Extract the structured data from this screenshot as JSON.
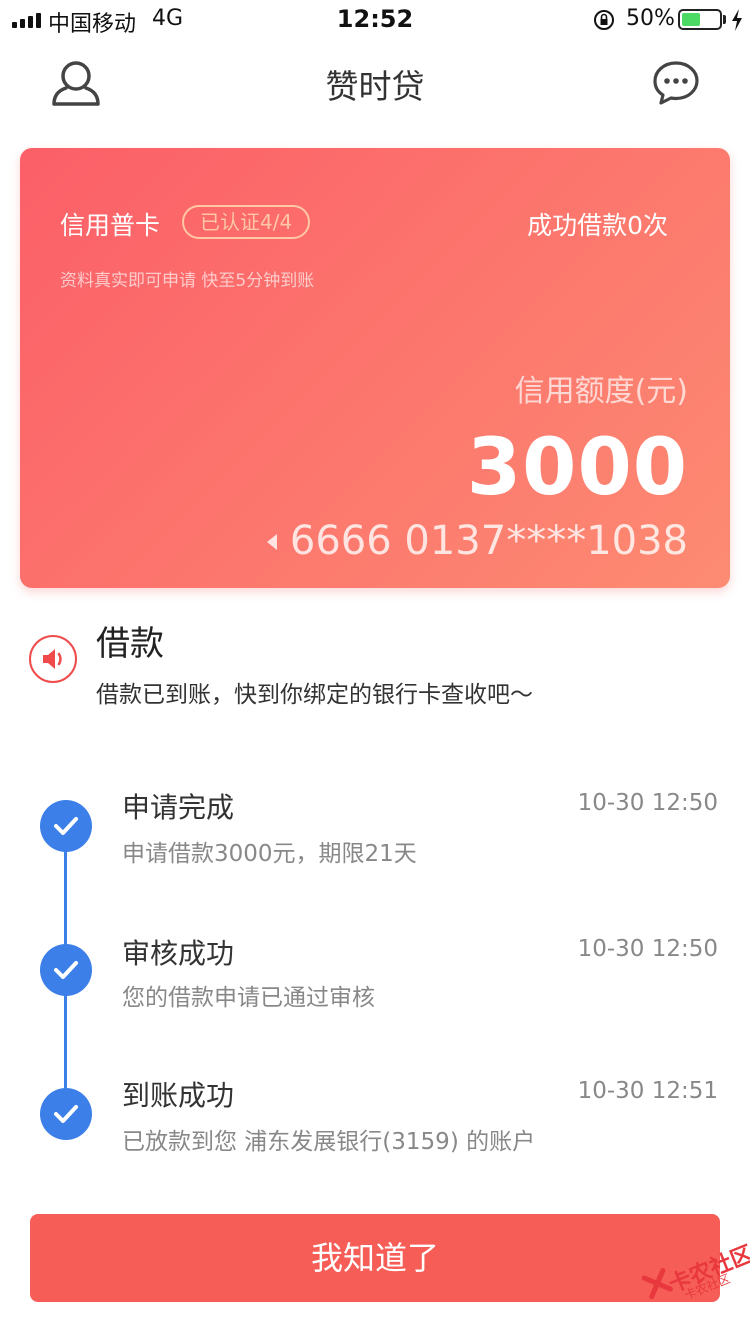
{
  "status_bar": {
    "carrier": "中国移动",
    "network": "4G",
    "time": "12:52",
    "battery_percent": "50%",
    "battery_level": 0.5,
    "icons": [
      "signal-icon",
      "rotation-lock-icon",
      "battery-icon",
      "charging-icon"
    ]
  },
  "nav": {
    "title": "赞时贷",
    "left_icon": "profile-icon",
    "right_icon": "message-icon"
  },
  "card": {
    "type_label": "信用普卡",
    "verified_badge": "已认证4/4",
    "success_count": "成功借款0次",
    "hint": "资料真实即可申请 快至5分钟到账",
    "limit_label": "信用额度(元)",
    "limit_amount": "3000",
    "card_number": "6666 0137****1038",
    "gradient_start": "#fb5f68",
    "gradient_end": "#fd8b72"
  },
  "notice": {
    "icon": "speaker-icon",
    "title": "借款",
    "text": "借款已到账，快到你绑定的银行卡查收吧～"
  },
  "timeline": {
    "steps": [
      {
        "title": "申请完成",
        "description": "申请借款3000元，期限21天",
        "time": "10-30 12:50"
      },
      {
        "title": "审核成功",
        "description": "您的借款申请已通过审核",
        "time": "10-30 12:50"
      },
      {
        "title": "到账成功",
        "description": "已放款到您 浦东发展银行(3159) 的账户",
        "time": "10-30 12:51"
      }
    ],
    "accent_color": "#3d7fe8"
  },
  "action": {
    "button_label": "我知道了",
    "button_color": "#f55d56"
  },
  "watermark": {
    "text": "卡农社区",
    "subtext": "卡农社区"
  }
}
